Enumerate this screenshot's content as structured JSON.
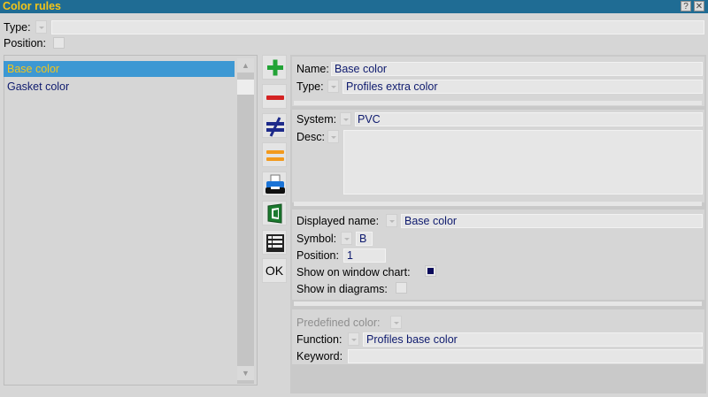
{
  "window": {
    "title": "Color rules",
    "help_btn": "?",
    "close_btn": "✕"
  },
  "header": {
    "type_label": "Type:",
    "position_label": "Position:"
  },
  "list": {
    "items": [
      "Base color",
      "Gasket color"
    ],
    "selected_index": 0
  },
  "toolbar": {
    "tools": [
      "plus-icon",
      "minus-icon",
      "not-equal-icon",
      "equal-icon",
      "printer-icon",
      "export-icon",
      "table-icon"
    ],
    "ok_label": "OK",
    "colors": {
      "add": "#22a336",
      "remove": "#d42323",
      "not_equal": "#1d2a8a",
      "equal": "#f29a1e"
    }
  },
  "details": {
    "name_label": "Name:",
    "name_value": "Base color",
    "type_label": "Type:",
    "type_value": "Profiles extra color",
    "system_label": "System:",
    "system_value": "PVC",
    "desc_label": "Desc:",
    "desc_value": "",
    "displayed_name_label": "Displayed name:",
    "displayed_name_value": "Base color",
    "symbol_label": "Symbol:",
    "symbol_value": "B",
    "position_label": "Position:",
    "position_value": "1",
    "show_window_chart_label": "Show on window chart:",
    "show_window_chart_color": "#0a0a5a",
    "show_diagrams_label": "Show in diagrams:",
    "predefined_color_label": "Predefined color:",
    "function_label": "Function:",
    "function_value": "Profiles base color",
    "keyword_label": "Keyword:",
    "keyword_value": ""
  }
}
